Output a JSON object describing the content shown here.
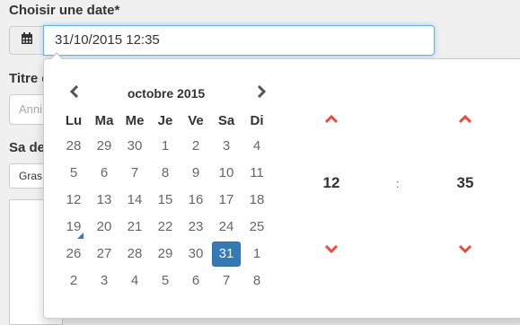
{
  "form": {
    "date_label": "Choisir une date*",
    "date_value": "31/10/2015 12:35",
    "title_label": "Titre d",
    "title_placeholder": "Anni",
    "description_label": "Sa des",
    "bold_button": "Gras"
  },
  "picker": {
    "month_label": "octobre 2015",
    "weekdays": [
      "Lu",
      "Ma",
      "Me",
      "Je",
      "Ve",
      "Sa",
      "Di"
    ],
    "weeks": [
      [
        "28",
        "29",
        "30",
        "1",
        "2",
        "3",
        "4"
      ],
      [
        "5",
        "6",
        "7",
        "8",
        "9",
        "10",
        "11"
      ],
      [
        "12",
        "13",
        "14",
        "15",
        "16",
        "17",
        "18"
      ],
      [
        "19",
        "20",
        "21",
        "22",
        "23",
        "24",
        "25"
      ],
      [
        "26",
        "27",
        "28",
        "29",
        "30",
        "31",
        "1"
      ],
      [
        "2",
        "3",
        "4",
        "5",
        "6",
        "7",
        "8"
      ]
    ],
    "selected_day": "31",
    "today_day": "19",
    "time": {
      "hours": "12",
      "separator": ":",
      "minutes": "35"
    }
  },
  "icons": {
    "calendar": "calendar-icon",
    "prev": "chevron-left-icon",
    "next": "chevron-right-icon",
    "up": "chevron-up-icon",
    "down": "chevron-down-icon"
  },
  "colors": {
    "accent": "#337ab7",
    "time_arrow": "#e74c3c"
  }
}
